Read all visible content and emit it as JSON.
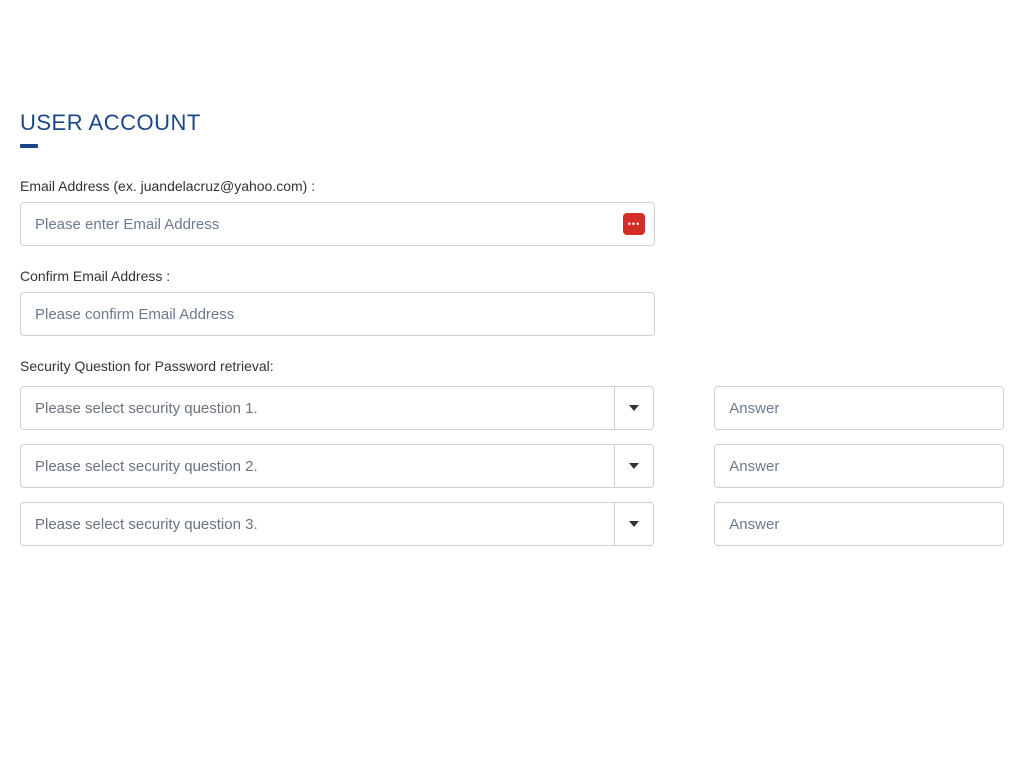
{
  "section": {
    "title": "USER ACCOUNT"
  },
  "email": {
    "label": "Email Address (ex. juandelacruz@yahoo.com) :",
    "placeholder": "Please enter Email Address"
  },
  "confirmEmail": {
    "label": "Confirm Email Address :",
    "placeholder": "Please confirm Email Address"
  },
  "security": {
    "label": "Security Question for Password retrieval:",
    "questions": [
      {
        "placeholder": "Please select security question 1.",
        "answerPlaceholder": "Answer"
      },
      {
        "placeholder": "Please select security question 2.",
        "answerPlaceholder": "Answer"
      },
      {
        "placeholder": "Please select security question 3.",
        "answerPlaceholder": "Answer"
      }
    ]
  }
}
